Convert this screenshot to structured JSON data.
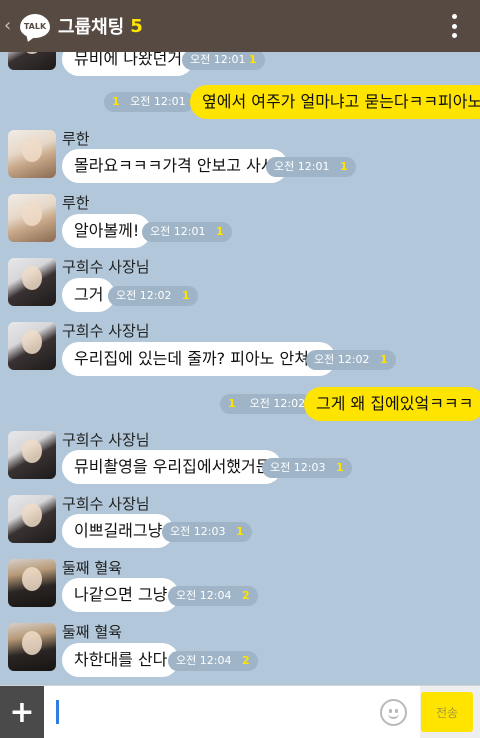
{
  "header": {
    "back_icon": "chevron-left-icon",
    "logo_text": "TALK",
    "title": "그룹채팅",
    "member_count": "5",
    "menu_icon": "more-vertical-icon"
  },
  "messages": [
    {
      "side": "in",
      "text": "뮤비에 나왔던거",
      "time": "오전 12:01",
      "unread": "1"
    },
    {
      "side": "out",
      "text": "옆에서 여주가 얼마냐고 묻는다ㅋㅋ피아노",
      "time": "오전 12:01",
      "unread": "1"
    },
    {
      "side": "in",
      "sender": "루한",
      "text": "몰라요ㅋㅋㅋ가격 안보고 사서",
      "time": "오전 12:01",
      "unread": "1"
    },
    {
      "side": "in",
      "sender": "루한",
      "text": "알아볼께!",
      "time": "오전 12:01",
      "unread": "1"
    },
    {
      "side": "in",
      "sender": "구희수 사장님",
      "text": "그거",
      "time": "오전 12:02",
      "unread": "1"
    },
    {
      "side": "in",
      "sender": "구희수 사장님",
      "text": "우리집에 있는데 줄까? 피아노 안쳐서",
      "time": "오전 12:02",
      "unread": "1"
    },
    {
      "side": "out",
      "text": "그게 왜 집에있엌ㅋㅋㅋ",
      "time": "오전 12:02",
      "unread": "1"
    },
    {
      "side": "in",
      "sender": "구희수 사장님",
      "text": "뮤비촬영을 우리집에서했거든",
      "time": "오전 12:03",
      "unread": "1"
    },
    {
      "side": "in",
      "sender": "구희수 사장님",
      "text": "이쁘길래그냥",
      "time": "오전 12:03",
      "unread": "1"
    },
    {
      "side": "in",
      "sender": "둘째 혈육",
      "text": "나같으면 그냥",
      "time": "오전 12:04",
      "unread": "2"
    },
    {
      "side": "in",
      "sender": "둘째 혈육",
      "text": "차한대를 산다",
      "time": "오전 12:04",
      "unread": "2"
    }
  ],
  "input": {
    "plus_icon": "plus-icon",
    "value": "",
    "emoji_icon": "emoji-icon",
    "send_label": "전송"
  },
  "colors": {
    "background": "#b2c7d9",
    "header": "#564a43",
    "accent_yellow": "#ffe400",
    "incoming_bubble": "#ffffff",
    "outgoing_bubble": "#ffe400"
  }
}
